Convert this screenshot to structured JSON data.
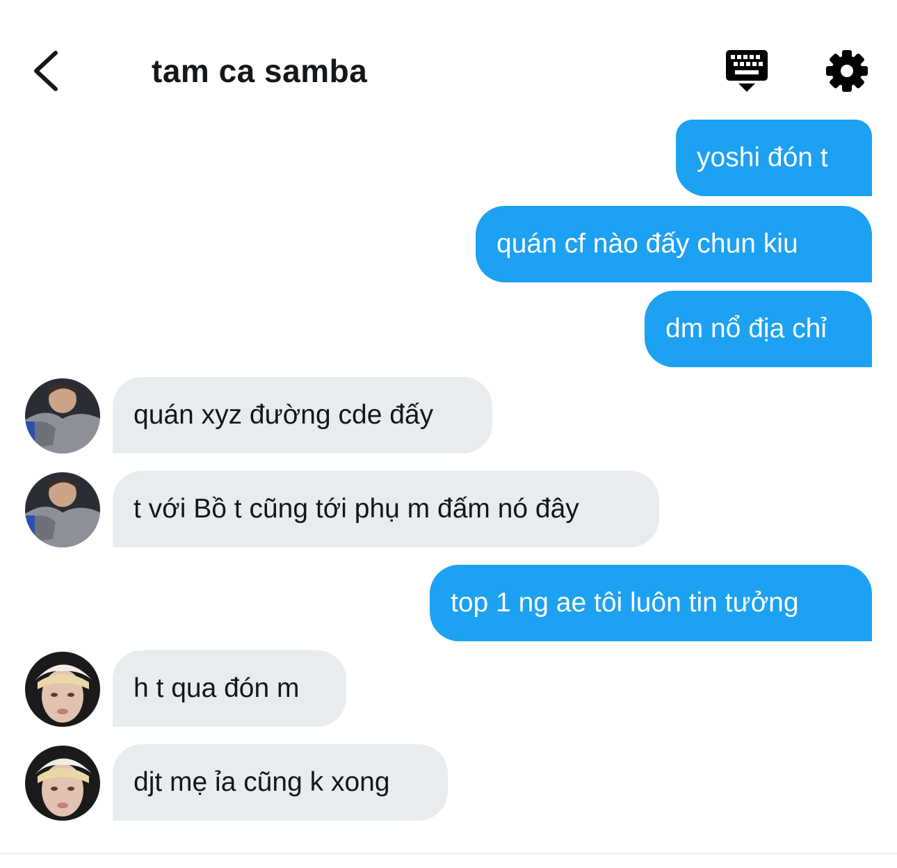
{
  "header": {
    "back_icon": "chevron-left-icon",
    "title": "tam ca samba",
    "keyboard_icon": "keyboard-icon",
    "settings_icon": "gear-icon"
  },
  "colors": {
    "sent_bubble": "#1da1f2",
    "received_bubble": "#e8ecef",
    "text_dark": "#14171a"
  },
  "messages": [
    {
      "direction": "sent",
      "text": "yoshi đón t"
    },
    {
      "direction": "sent",
      "text": "quán cf nào đấy chun kiu"
    },
    {
      "direction": "sent",
      "text": "dm nổ địa chỉ"
    },
    {
      "direction": "received",
      "sender_avatar": "avatar-1",
      "text": "quán xyz đường cde đấy"
    },
    {
      "direction": "received",
      "sender_avatar": "avatar-1",
      "text": "t với Bồ t cũng tới phụ m đấm nó đây"
    },
    {
      "direction": "sent",
      "text": "top 1 ng ae tôi luôn tin tưởng"
    },
    {
      "direction": "received",
      "sender_avatar": "avatar-2",
      "text": "h t qua đón m"
    },
    {
      "direction": "received",
      "sender_avatar": "avatar-2",
      "text": "djt mẹ ỉa cũng k xong"
    }
  ]
}
